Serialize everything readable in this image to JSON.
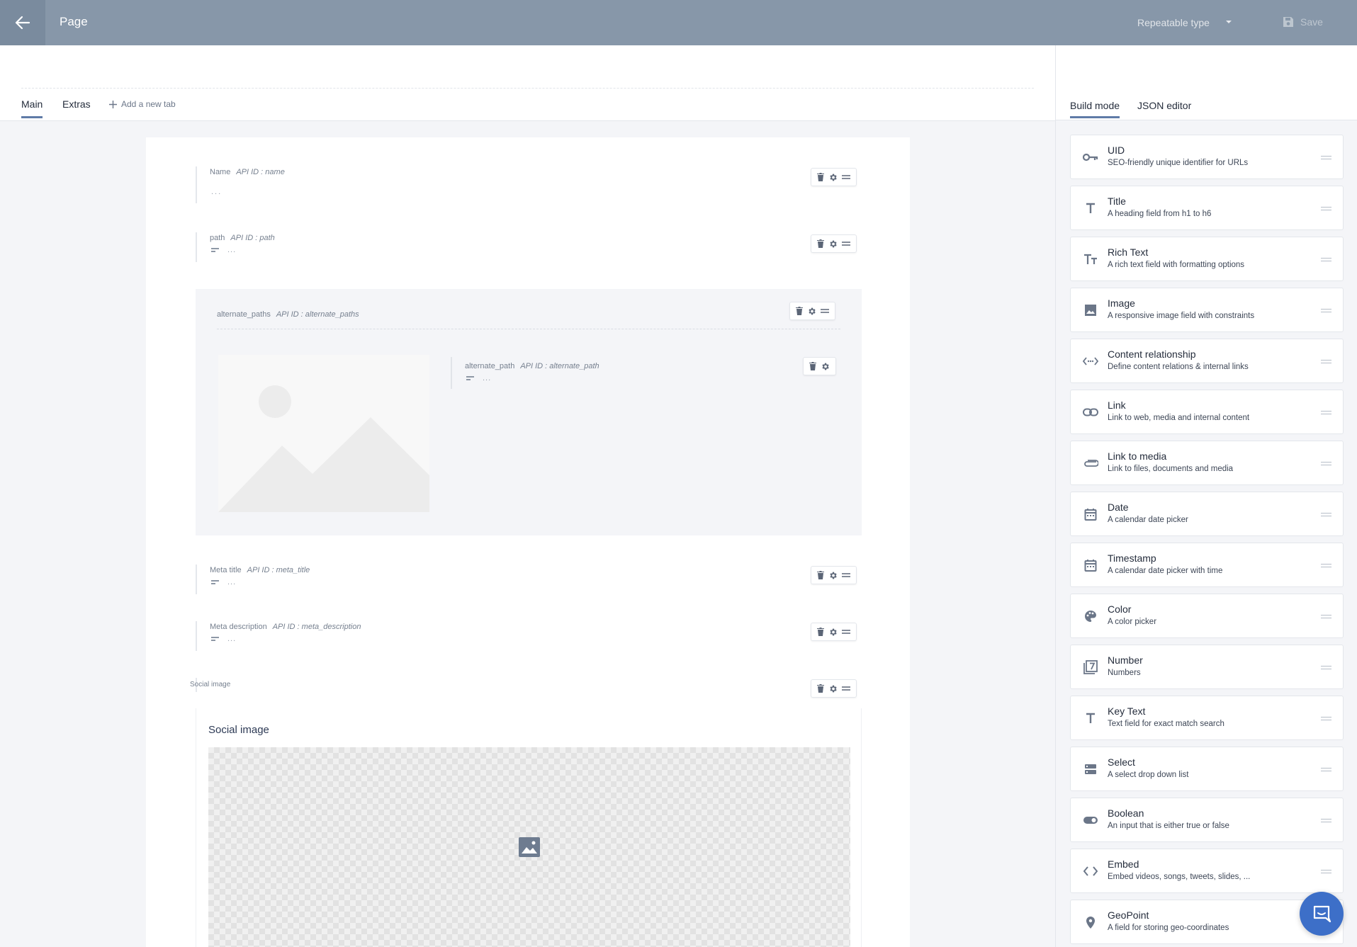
{
  "header": {
    "title": "Page",
    "repeatable_type": "Repeatable type",
    "save_label": "Save"
  },
  "tabs": [
    {
      "label": "Main",
      "active": true
    },
    {
      "label": "Extras",
      "active": false
    }
  ],
  "add_tab_label": "Add a new tab",
  "fields": {
    "name": {
      "label": "Name",
      "api": "API ID : name",
      "placeholder": "..."
    },
    "path": {
      "label": "path",
      "api": "API ID : path",
      "placeholder": "..."
    },
    "alternate_paths": {
      "label": "alternate_paths",
      "api": "API ID : alternate_paths"
    },
    "alternate_path": {
      "label": "alternate_path",
      "api": "API ID : alternate_path",
      "placeholder": "..."
    },
    "meta_title": {
      "label": "Meta title",
      "api": "API ID : meta_title",
      "placeholder": "..."
    },
    "meta_description": {
      "label": "Meta description",
      "api": "API ID : meta_description",
      "placeholder": "..."
    },
    "social_image": {
      "label": "Social image",
      "title": "Social image"
    }
  },
  "right_panel": {
    "tabs": [
      {
        "label": "Build mode",
        "active": true
      },
      {
        "label": "JSON editor",
        "active": false
      }
    ],
    "widgets": [
      {
        "title": "UID",
        "desc": "SEO-friendly unique identifier for URLs",
        "icon": "key-icon"
      },
      {
        "title": "Title",
        "desc": "A heading field from h1 to h6",
        "icon": "title-icon"
      },
      {
        "title": "Rich Text",
        "desc": "A rich text field with formatting options",
        "icon": "rich-text-icon"
      },
      {
        "title": "Image",
        "desc": "A responsive image field with constraints",
        "icon": "image-icon"
      },
      {
        "title": "Content relationship",
        "desc": "Define content relations & internal links",
        "icon": "relationship-icon"
      },
      {
        "title": "Link",
        "desc": "Link to web, media and internal content",
        "icon": "link-icon"
      },
      {
        "title": "Link to media",
        "desc": "Link to files, documents and media",
        "icon": "paperclip-icon"
      },
      {
        "title": "Date",
        "desc": "A calendar date picker",
        "icon": "calendar-icon"
      },
      {
        "title": "Timestamp",
        "desc": "A calendar date picker with time",
        "icon": "calendar-icon"
      },
      {
        "title": "Color",
        "desc": "A color picker",
        "icon": "palette-icon"
      },
      {
        "title": "Number",
        "desc": "Numbers",
        "icon": "number-icon"
      },
      {
        "title": "Key Text",
        "desc": "Text field for exact match search",
        "icon": "key-text-icon"
      },
      {
        "title": "Select",
        "desc": "A select drop down list",
        "icon": "select-icon"
      },
      {
        "title": "Boolean",
        "desc": "An input that is either true or false",
        "icon": "toggle-icon"
      },
      {
        "title": "Embed",
        "desc": "Embed videos, songs, tweets, slides, ...",
        "icon": "code-icon"
      },
      {
        "title": "GeoPoint",
        "desc": "A field for storing geo-coordinates",
        "icon": "map-pin-icon"
      }
    ]
  },
  "colors": {
    "topbar": "#8797a9",
    "accent": "#5f7ba7",
    "chat": "#3d6fc8"
  }
}
